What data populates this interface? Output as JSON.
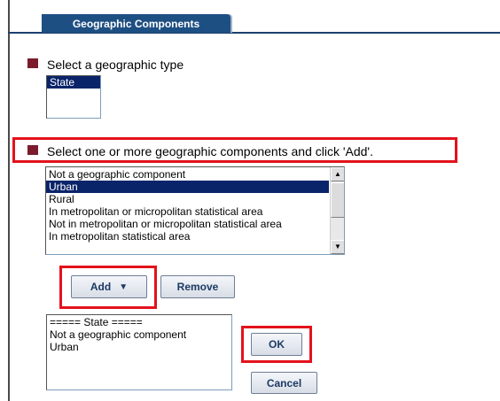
{
  "tab": {
    "label": "Geographic Components"
  },
  "section1": {
    "label": "Select a geographic type",
    "options": [
      {
        "label": "State",
        "selected": true
      }
    ]
  },
  "section2": {
    "label": "Select one or more geographic components and click 'Add'.",
    "options": [
      {
        "label": "Not a geographic component",
        "selected": false
      },
      {
        "label": "Urban",
        "selected": true
      },
      {
        "label": "Rural",
        "selected": false
      },
      {
        "label": "In metropolitan or micropolitan statistical area",
        "selected": false
      },
      {
        "label": "Not in metropolitan or micropolitan statistical area",
        "selected": false
      },
      {
        "label": "In metropolitan statistical area",
        "selected": false
      }
    ]
  },
  "buttons": {
    "add_label": "Add",
    "add_icon": "dropdown-arrow-icon",
    "remove_label": "Remove",
    "ok_label": "OK",
    "cancel_label": "Cancel"
  },
  "selected_list": {
    "items": [
      "===== State =====",
      "Not a geographic component",
      "Urban"
    ]
  },
  "colors": {
    "tab_bg": "#1e4f82",
    "bullet": "#7b1b2c",
    "highlight": "#e3121b",
    "selection_bg": "#0a246a",
    "button_text": "#1c3a63"
  }
}
